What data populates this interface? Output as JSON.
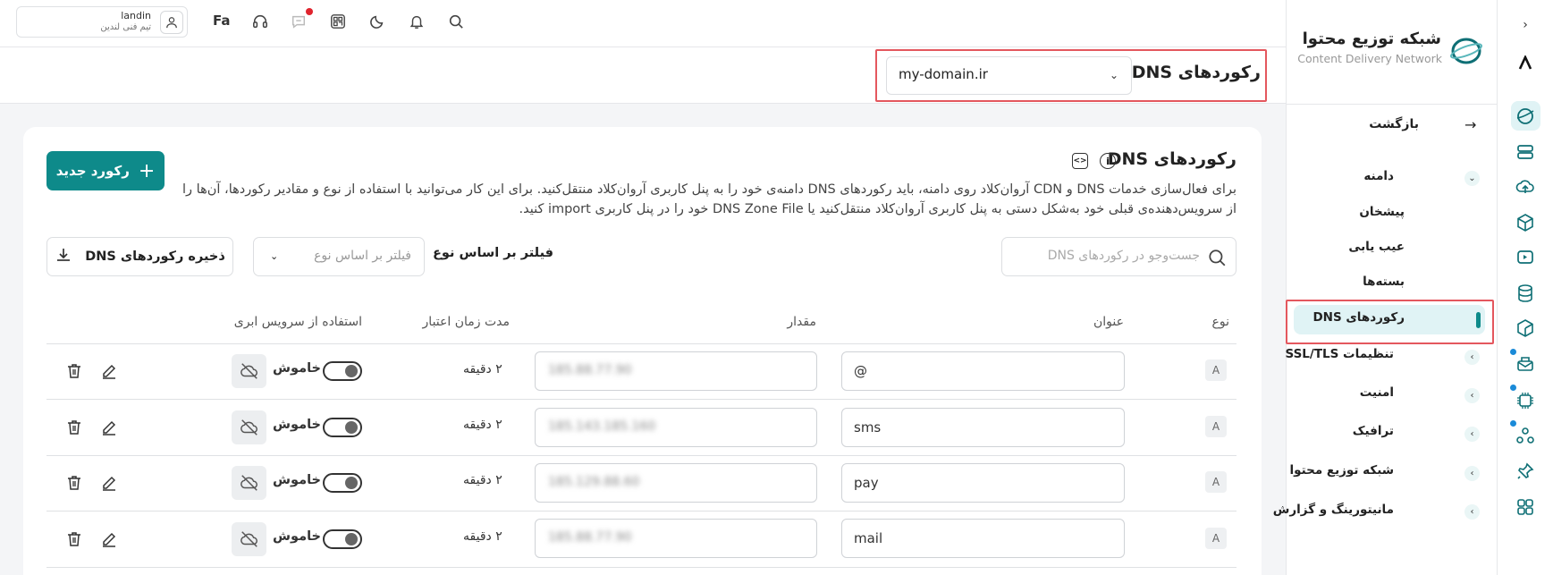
{
  "topbar": {
    "user_name": "landin",
    "user_team": "تیم فنی لندین",
    "lang": "Fa"
  },
  "subbar": {
    "title": "رکوردهای DNS",
    "domain": "my-domain.ir"
  },
  "card": {
    "title": "رکوردهای DNS",
    "description": "برای فعال‌سازی خدمات DNS و CDN آروان‌کلاد روی دامنه، باید رکوردهای DNS دامنه‌ی خود را به پنل کاربری آروان‌کلاد منتقل‌کنید. برای این کار می‌توانید با استفاده از نوع و مقادیر رکوردها، آن‌ها را از سرویس‌دهنده‌ی قبلی خود به‌شکل دستی به پنل کاربری آروان‌کلاد منتقل‌کنید یا DNS Zone File خود را در پنل کاربری import کنید.",
    "new_record_label": "رکورد جدید",
    "search_placeholder": "جست‌وجو در رکوردهای DNS",
    "filter_label": "فیلتر بر اساس نوع",
    "filter_placeholder": "فیلتر بر اساس نوع",
    "save_label": "ذخیره رکوردهای DNS"
  },
  "table": {
    "headers": {
      "type": "نوع",
      "title": "عنوان",
      "value": "مقدار",
      "ttl": "مدت زمان اعتبار",
      "cloud": "استفاده از سرویس ابری"
    },
    "rows": [
      {
        "type": "A",
        "title": "@",
        "value": "185.88.77.90",
        "ttl": "۲ دقیقه",
        "status": "خاموش"
      },
      {
        "type": "A",
        "title": "sms",
        "value": "185.143.185.160",
        "ttl": "۲ دقیقه",
        "status": "خاموش"
      },
      {
        "type": "A",
        "title": "pay",
        "value": "185.129.88.60",
        "ttl": "۲ دقیقه",
        "status": "خاموش"
      },
      {
        "type": "A",
        "title": "mail",
        "value": "185.88.77.90",
        "ttl": "۲ دقیقه",
        "status": "خاموش"
      }
    ]
  },
  "sidebar": {
    "brand_title": "شبکه توزیع محتوا",
    "brand_subtitle": "Content Delivery Network",
    "back": "بازگشت",
    "domain_group": "دامنه",
    "items": [
      {
        "label": "پیشخان"
      },
      {
        "label": "عیب یابی"
      },
      {
        "label": "بسته‌ها"
      },
      {
        "label": "رکوردهای DNS"
      },
      {
        "label": "تنظیمات SSL/TLS"
      },
      {
        "label": "امنیت"
      },
      {
        "label": "ترافیک"
      },
      {
        "label": "شبکه توزیع محتوا"
      },
      {
        "label": "مانیتورینگ و گزارش"
      }
    ]
  },
  "colors": {
    "accent": "#0e8a8a",
    "highlight": "#e4575e",
    "active_bg": "#e0f3f5"
  }
}
